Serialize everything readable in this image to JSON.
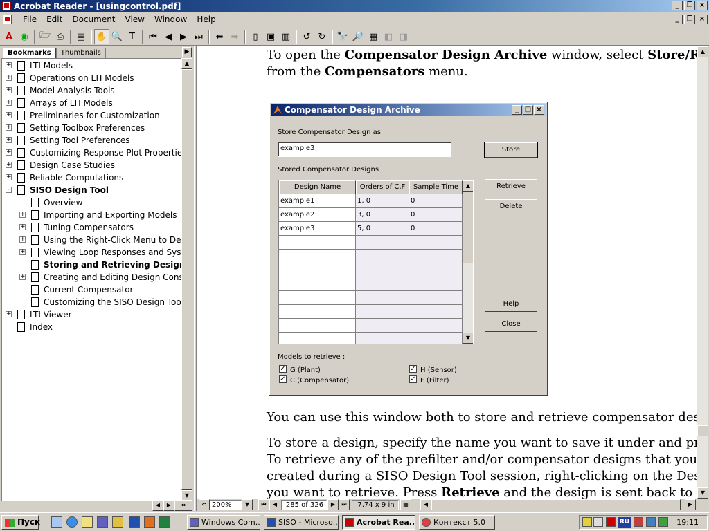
{
  "window": {
    "title": "Acrobat Reader - [usingcontrol.pdf]"
  },
  "menu": [
    "File",
    "Edit",
    "Document",
    "View",
    "Window",
    "Help"
  ],
  "toolbar": {
    "icons": [
      "acrobat-icon",
      "web-capture-icon",
      "open-icon",
      "print-icon",
      "show-hide-navpane-icon",
      "hand-tool-icon",
      "zoom-tool-icon",
      "text-select-icon",
      "first-page-icon",
      "previous-page-icon",
      "next-page-icon",
      "last-page-icon",
      "go-back-icon",
      "go-forward-icon",
      "actual-size-icon",
      "fit-page-icon",
      "fit-width-icon",
      "rotate-left-icon",
      "rotate-right-icon",
      "find-icon",
      "search-icon",
      "search-results-icon",
      "search-previous-icon",
      "search-next-icon"
    ]
  },
  "nav": {
    "tabs": [
      "Bookmarks",
      "Thumbnails"
    ],
    "bookmarks": [
      {
        "label": "LTI Models",
        "level": 0,
        "expand": "+",
        "bold": false
      },
      {
        "label": "Operations on LTI Models",
        "level": 0,
        "expand": "+",
        "bold": false
      },
      {
        "label": "Model Analysis Tools",
        "level": 0,
        "expand": "+",
        "bold": false
      },
      {
        "label": "Arrays of LTI Models",
        "level": 0,
        "expand": "+",
        "bold": false
      },
      {
        "label": "Preliminaries for Customization",
        "level": 0,
        "expand": "+",
        "bold": false
      },
      {
        "label": "Setting Toolbox Preferences",
        "level": 0,
        "expand": "+",
        "bold": false
      },
      {
        "label": "Setting Tool Preferences",
        "level": 0,
        "expand": "+",
        "bold": false
      },
      {
        "label": "Customizing Response Plot Properties",
        "level": 0,
        "expand": "+",
        "bold": false
      },
      {
        "label": "Design Case Studies",
        "level": 0,
        "expand": "+",
        "bold": false
      },
      {
        "label": "Reliable Computations",
        "level": 0,
        "expand": "+",
        "bold": false
      },
      {
        "label": "SISO Design Tool",
        "level": 0,
        "expand": "-",
        "bold": true
      },
      {
        "label": "Overview",
        "level": 1,
        "expand": "",
        "bold": false
      },
      {
        "label": "Importing and Exporting Models",
        "level": 1,
        "expand": "+",
        "bold": false
      },
      {
        "label": "Tuning Compensators",
        "level": 1,
        "expand": "+",
        "bold": false
      },
      {
        "label": "Using the Right-Click Menu to Design",
        "level": 1,
        "expand": "+",
        "bold": false
      },
      {
        "label": "Viewing Loop Responses and System",
        "level": 1,
        "expand": "+",
        "bold": false
      },
      {
        "label": "Storing and Retrieving Designs",
        "level": 1,
        "expand": "",
        "bold": true
      },
      {
        "label": "Creating and Editing Design Constra",
        "level": 1,
        "expand": "+",
        "bold": false
      },
      {
        "label": "Current Compensator",
        "level": 1,
        "expand": "",
        "bold": false
      },
      {
        "label": "Customizing the SISO Design Tool",
        "level": 1,
        "expand": "",
        "bold": false
      },
      {
        "label": "LTI Viewer",
        "level": 0,
        "expand": "+",
        "bold": false
      },
      {
        "label": "Index",
        "level": 0,
        "expand": "",
        "bold": false
      }
    ]
  },
  "doc": {
    "line1_a": "To open the ",
    "line1_b": "Compensator Design Archive",
    "line1_c": " window, select ",
    "line1_d": "Store/R",
    "line2_a": "from the ",
    "line2_b": "Compensators",
    "line2_c": " menu.",
    "para2": "You can use this window both to store and retrieve compensator des",
    "para3_1": "To store a design, specify the name you want to save it under and pr",
    "para3_2": "To retrieve any of the prefilter and/or compensator designs that you",
    "para3_3": "created during a SISO Design Tool session, right-clicking on the Des",
    "para3_4a": "you want to retrieve. Press ",
    "para3_4b": "Retrieve",
    "para3_4c": " and the design is sent back to"
  },
  "dialog": {
    "title": "Compensator Design Archive",
    "store_label": "Store Compensator Design as",
    "store_value": "example3",
    "stored_label": "Stored Compensator Designs",
    "columns": [
      "Design Name",
      "Orders of C,F",
      "Sample Time"
    ],
    "rows": [
      [
        "example1",
        "1, 0",
        "0"
      ],
      [
        "example2",
        "3, 0",
        "0"
      ],
      [
        "example3",
        "5, 0",
        "0"
      ]
    ],
    "buttons": {
      "store": "Store",
      "retrieve": "Retrieve",
      "delete": "Delete",
      "help": "Help",
      "close": "Close"
    },
    "models_label": "Models to retrieve :",
    "checks": [
      {
        "label": "G  (Plant)",
        "checked": true
      },
      {
        "label": "H  (Sensor)",
        "checked": true
      },
      {
        "label": "C  (Compensator)",
        "checked": true
      },
      {
        "label": "F  (Filter)",
        "checked": true
      }
    ]
  },
  "status": {
    "zoom": "200%",
    "page": "285 of 326",
    "size": "7,74 x 9 in"
  },
  "taskbar": {
    "start": "Пуск",
    "tasks": [
      "Windows Com...",
      "SISO - Microso...",
      "Acrobat Rea...",
      "Контекст 5.0"
    ],
    "lang": "RU",
    "clock": "19:11"
  }
}
